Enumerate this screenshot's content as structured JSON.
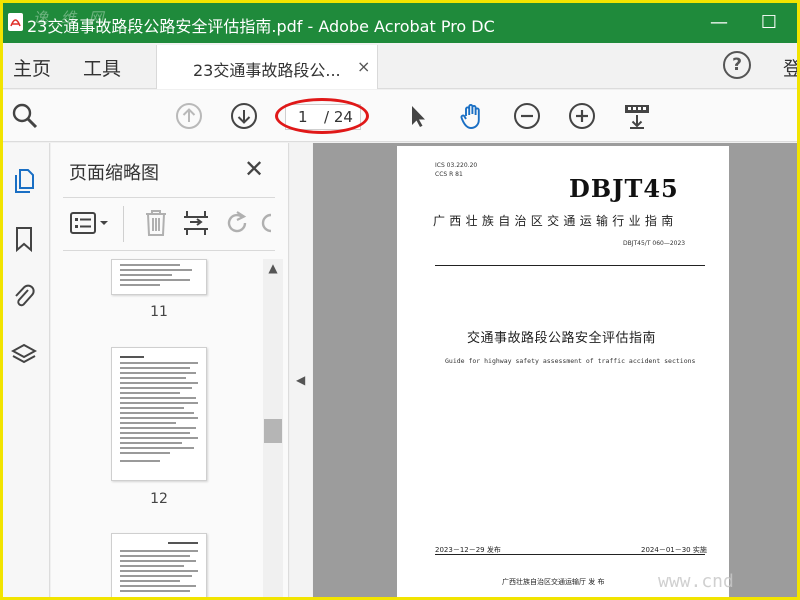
{
  "window": {
    "title": "23交通事故路段公路安全评估指南.pdf - Adobe Acrobat Pro DC",
    "minimize": "—",
    "maximize": "☐"
  },
  "tabs": {
    "home": "主页",
    "tools": "工具",
    "document": "23交通事故路段公...",
    "close": "×",
    "help": "?",
    "signin": "登录"
  },
  "toolbar": {
    "current_page": "1",
    "total_pages": "/ 24"
  },
  "panel": {
    "title": "页面缩略图",
    "close": "✕",
    "scroll_up": "▲",
    "thumbnails": [
      {
        "label": "11"
      },
      {
        "label": "12"
      }
    ]
  },
  "collapse_arrow": "◀",
  "page": {
    "ics": "ICS  03.220.20",
    "ccs": "CCS R 81",
    "logo": "DBJT45",
    "org": "广西壮族自治区交通运输行业指南",
    "code": "DBJT45/T 060—2023",
    "title": "交通事故路段公路安全评估指南",
    "title_en": "Guide for highway safety assessment of traffic accident sections",
    "release_date": "2023－12－29 发布",
    "impl_date": "2024－01－30 实施",
    "publisher": "广西壮族自治区交通运输厅     发  布",
    "watermark": "www.cnd"
  },
  "colors": {
    "titlebar": "#1f8a3b",
    "frame": "#f2e400",
    "oval": "#e01818",
    "accent": "#1a6fc4"
  }
}
